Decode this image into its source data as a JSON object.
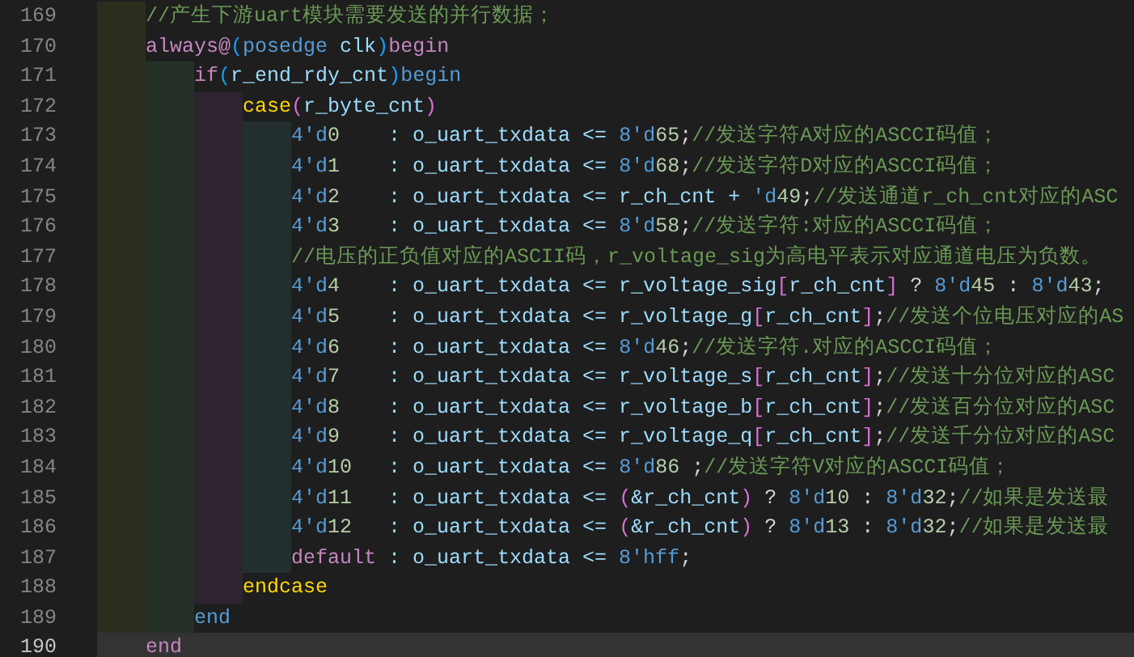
{
  "editor": {
    "lines": [
      {
        "number": "169",
        "current": false,
        "tokens": [
          {
            "kind": "comment",
            "text": "    //产生下游uart模块需要发送的并行数据；"
          }
        ]
      },
      {
        "number": "170",
        "current": false,
        "tokens": [
          {
            "kind": "keyword",
            "text": "    always@"
          },
          {
            "kind": "bracket1",
            "text": "("
          },
          {
            "kind": "base",
            "text": "posedge"
          },
          {
            "kind": "ident",
            "text": " clk"
          },
          {
            "kind": "bracket1",
            "text": ")"
          },
          {
            "kind": "keyword",
            "text": "begin"
          }
        ]
      },
      {
        "number": "171",
        "current": false,
        "tokens": [
          {
            "kind": "keyword",
            "text": "        if"
          },
          {
            "kind": "bracket1",
            "text": "("
          },
          {
            "kind": "ident",
            "text": "r_end_rdy_cnt"
          },
          {
            "kind": "bracket1",
            "text": ")"
          },
          {
            "kind": "base",
            "text": "begin"
          }
        ]
      },
      {
        "number": "172",
        "current": false,
        "tokens": [
          {
            "kind": "control",
            "text": "            case"
          },
          {
            "kind": "bracket2",
            "text": "("
          },
          {
            "kind": "ident",
            "text": "r_byte_cnt"
          },
          {
            "kind": "bracket2",
            "text": ")"
          }
        ]
      },
      {
        "number": "173",
        "current": false,
        "tokens": [
          {
            "kind": "base",
            "text": "                4'd"
          },
          {
            "kind": "number",
            "text": "0"
          },
          {
            "kind": "ident",
            "text": "    : o_uart_txdata <= "
          },
          {
            "kind": "base",
            "text": "8'd"
          },
          {
            "kind": "number",
            "text": "65"
          },
          {
            "kind": "plain",
            "text": ";"
          },
          {
            "kind": "comment",
            "text": "//发送字符A对应的ASCCI码值；"
          }
        ]
      },
      {
        "number": "174",
        "current": false,
        "tokens": [
          {
            "kind": "base",
            "text": "                4'd"
          },
          {
            "kind": "number",
            "text": "1"
          },
          {
            "kind": "ident",
            "text": "    : o_uart_txdata <= "
          },
          {
            "kind": "base",
            "text": "8'd"
          },
          {
            "kind": "number",
            "text": "68"
          },
          {
            "kind": "plain",
            "text": ";"
          },
          {
            "kind": "comment",
            "text": "//发送字符D对应的ASCCI码值；"
          }
        ]
      },
      {
        "number": "175",
        "current": false,
        "tokens": [
          {
            "kind": "base",
            "text": "                4'd"
          },
          {
            "kind": "number",
            "text": "2"
          },
          {
            "kind": "ident",
            "text": "    : o_uart_txdata <= r_ch_cnt + "
          },
          {
            "kind": "base",
            "text": "'d"
          },
          {
            "kind": "number",
            "text": "49"
          },
          {
            "kind": "plain",
            "text": ";"
          },
          {
            "kind": "comment",
            "text": "//发送通道r_ch_cnt对应的ASC"
          }
        ]
      },
      {
        "number": "176",
        "current": false,
        "tokens": [
          {
            "kind": "base",
            "text": "                4'd"
          },
          {
            "kind": "number",
            "text": "3"
          },
          {
            "kind": "ident",
            "text": "    : o_uart_txdata <= "
          },
          {
            "kind": "base",
            "text": "8'd"
          },
          {
            "kind": "number",
            "text": "58"
          },
          {
            "kind": "plain",
            "text": ";"
          },
          {
            "kind": "comment",
            "text": "//发送字符:对应的ASCCI码值；"
          }
        ]
      },
      {
        "number": "177",
        "current": false,
        "tokens": [
          {
            "kind": "comment",
            "text": "                //电压的正负值对应的ASCII码，r_voltage_sig为高电平表示对应通道电压为负数。"
          }
        ]
      },
      {
        "number": "178",
        "current": false,
        "tokens": [
          {
            "kind": "base",
            "text": "                4'd"
          },
          {
            "kind": "number",
            "text": "4"
          },
          {
            "kind": "ident",
            "text": "    : o_uart_txdata <= r_voltage_sig"
          },
          {
            "kind": "bracket2",
            "text": "["
          },
          {
            "kind": "ident",
            "text": "r_ch_cnt"
          },
          {
            "kind": "bracket2",
            "text": "]"
          },
          {
            "kind": "plain",
            "text": " ? "
          },
          {
            "kind": "base",
            "text": "8'd"
          },
          {
            "kind": "number",
            "text": "45"
          },
          {
            "kind": "plain",
            "text": " : "
          },
          {
            "kind": "base",
            "text": "8'd"
          },
          {
            "kind": "number",
            "text": "43"
          },
          {
            "kind": "plain",
            "text": ";"
          }
        ]
      },
      {
        "number": "179",
        "current": false,
        "tokens": [
          {
            "kind": "base",
            "text": "                4'd"
          },
          {
            "kind": "number",
            "text": "5"
          },
          {
            "kind": "ident",
            "text": "    : o_uart_txdata <= r_voltage_g"
          },
          {
            "kind": "bracket2",
            "text": "["
          },
          {
            "kind": "ident",
            "text": "r_ch_cnt"
          },
          {
            "kind": "bracket2",
            "text": "]"
          },
          {
            "kind": "plain",
            "text": ";"
          },
          {
            "kind": "comment",
            "text": "//发送个位电压对应的AS"
          }
        ]
      },
      {
        "number": "180",
        "current": false,
        "tokens": [
          {
            "kind": "base",
            "text": "                4'd"
          },
          {
            "kind": "number",
            "text": "6"
          },
          {
            "kind": "ident",
            "text": "    : o_uart_txdata <= "
          },
          {
            "kind": "base",
            "text": "8'd"
          },
          {
            "kind": "number",
            "text": "46"
          },
          {
            "kind": "plain",
            "text": ";"
          },
          {
            "kind": "comment",
            "text": "//发送字符.对应的ASCCI码值；"
          }
        ]
      },
      {
        "number": "181",
        "current": false,
        "tokens": [
          {
            "kind": "base",
            "text": "                4'd"
          },
          {
            "kind": "number",
            "text": "7"
          },
          {
            "kind": "ident",
            "text": "    : o_uart_txdata <= r_voltage_s"
          },
          {
            "kind": "bracket2",
            "text": "["
          },
          {
            "kind": "ident",
            "text": "r_ch_cnt"
          },
          {
            "kind": "bracket2",
            "text": "]"
          },
          {
            "kind": "plain",
            "text": ";"
          },
          {
            "kind": "comment",
            "text": "//发送十分位对应的ASC"
          }
        ]
      },
      {
        "number": "182",
        "current": false,
        "tokens": [
          {
            "kind": "base",
            "text": "                4'd"
          },
          {
            "kind": "number",
            "text": "8"
          },
          {
            "kind": "ident",
            "text": "    : o_uart_txdata <= r_voltage_b"
          },
          {
            "kind": "bracket2",
            "text": "["
          },
          {
            "kind": "ident",
            "text": "r_ch_cnt"
          },
          {
            "kind": "bracket2",
            "text": "]"
          },
          {
            "kind": "plain",
            "text": ";"
          },
          {
            "kind": "comment",
            "text": "//发送百分位对应的ASC"
          }
        ]
      },
      {
        "number": "183",
        "current": false,
        "tokens": [
          {
            "kind": "base",
            "text": "                4'd"
          },
          {
            "kind": "number",
            "text": "9"
          },
          {
            "kind": "ident",
            "text": "    : o_uart_txdata <= r_voltage_q"
          },
          {
            "kind": "bracket2",
            "text": "["
          },
          {
            "kind": "ident",
            "text": "r_ch_cnt"
          },
          {
            "kind": "bracket2",
            "text": "]"
          },
          {
            "kind": "plain",
            "text": ";"
          },
          {
            "kind": "comment",
            "text": "//发送千分位对应的ASC"
          }
        ]
      },
      {
        "number": "184",
        "current": false,
        "tokens": [
          {
            "kind": "base",
            "text": "                4'd"
          },
          {
            "kind": "number",
            "text": "10"
          },
          {
            "kind": "ident",
            "text": "   : o_uart_txdata <= "
          },
          {
            "kind": "base",
            "text": "8'd"
          },
          {
            "kind": "number",
            "text": "86"
          },
          {
            "kind": "plain",
            "text": " ;"
          },
          {
            "kind": "comment",
            "text": "//发送字符V对应的ASCCI码值；"
          }
        ]
      },
      {
        "number": "185",
        "current": false,
        "tokens": [
          {
            "kind": "base",
            "text": "                4'd"
          },
          {
            "kind": "number",
            "text": "11"
          },
          {
            "kind": "ident",
            "text": "   : o_uart_txdata <= "
          },
          {
            "kind": "bracket2",
            "text": "("
          },
          {
            "kind": "ident",
            "text": "&r_ch_cnt"
          },
          {
            "kind": "bracket2",
            "text": ")"
          },
          {
            "kind": "plain",
            "text": " ? "
          },
          {
            "kind": "base",
            "text": "8'd"
          },
          {
            "kind": "number",
            "text": "10"
          },
          {
            "kind": "plain",
            "text": " : "
          },
          {
            "kind": "base",
            "text": "8'd"
          },
          {
            "kind": "number",
            "text": "32"
          },
          {
            "kind": "plain",
            "text": ";"
          },
          {
            "kind": "comment",
            "text": "//如果是发送最"
          }
        ]
      },
      {
        "number": "186",
        "current": false,
        "tokens": [
          {
            "kind": "base",
            "text": "                4'd"
          },
          {
            "kind": "number",
            "text": "12"
          },
          {
            "kind": "ident",
            "text": "   : o_uart_txdata <= "
          },
          {
            "kind": "bracket2",
            "text": "("
          },
          {
            "kind": "ident",
            "text": "&r_ch_cnt"
          },
          {
            "kind": "bracket2",
            "text": ")"
          },
          {
            "kind": "plain",
            "text": " ? "
          },
          {
            "kind": "base",
            "text": "8'd"
          },
          {
            "kind": "number",
            "text": "13"
          },
          {
            "kind": "plain",
            "text": " : "
          },
          {
            "kind": "base",
            "text": "8'd"
          },
          {
            "kind": "number",
            "text": "32"
          },
          {
            "kind": "plain",
            "text": ";"
          },
          {
            "kind": "comment",
            "text": "//如果是发送最"
          }
        ]
      },
      {
        "number": "187",
        "current": false,
        "tokens": [
          {
            "kind": "keyword",
            "text": "                default"
          },
          {
            "kind": "ident",
            "text": " : o_uart_txdata <= "
          },
          {
            "kind": "base",
            "text": "8'hff"
          },
          {
            "kind": "plain",
            "text": ";"
          }
        ]
      },
      {
        "number": "188",
        "current": false,
        "tokens": [
          {
            "kind": "control",
            "text": "            endcase"
          }
        ]
      },
      {
        "number": "189",
        "current": false,
        "tokens": [
          {
            "kind": "base",
            "text": "        end"
          }
        ]
      },
      {
        "number": "190",
        "current": true,
        "tokens": [
          {
            "kind": "keyword",
            "text": "    end"
          }
        ]
      }
    ]
  }
}
